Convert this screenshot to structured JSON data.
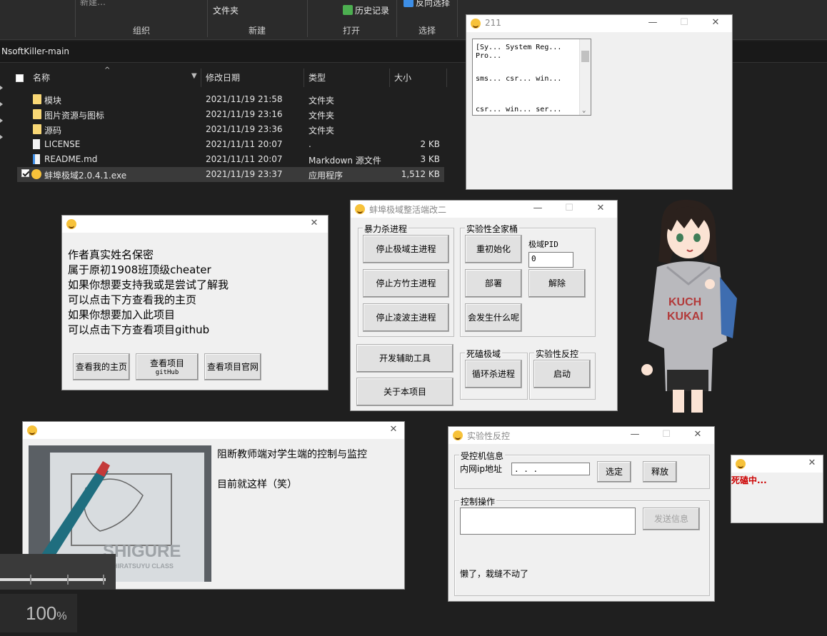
{
  "ribbon": {
    "top_text_1": "新建…",
    "folder_label": "文件夹",
    "history": "历史记录",
    "invert_select": "反向选择",
    "groups": [
      "组织",
      "新建",
      "打开",
      "选择"
    ]
  },
  "address": "NsoftKiller-main",
  "columns": {
    "name": "名称",
    "modified": "修改日期",
    "type": "类型",
    "size": "大小"
  },
  "files": [
    {
      "name": "模块",
      "modified": "2021/11/19 21:58",
      "type": "文件夹",
      "size": "",
      "icon": "folder-icon"
    },
    {
      "name": "图片资源与图标",
      "modified": "2021/11/19 23:16",
      "type": "文件夹",
      "size": "",
      "icon": "folder-icon"
    },
    {
      "name": "源码",
      "modified": "2021/11/19 23:36",
      "type": "文件夹",
      "size": "",
      "icon": "folder-icon"
    },
    {
      "name": "LICENSE",
      "modified": "2021/11/11 20:07",
      "type": ".",
      "size": "2 KB",
      "icon": "document-icon"
    },
    {
      "name": "README.md",
      "modified": "2021/11/11 20:07",
      "type": "Markdown 源文件",
      "size": "3 KB",
      "icon": "markdown-icon"
    },
    {
      "name": "蚌埠极域2.0.4.1.exe",
      "modified": "2021/11/19 23:37",
      "type": "应用程序",
      "size": "1,512 KB",
      "icon": "exe-icon",
      "selected": true
    }
  ],
  "win211": {
    "title": "211",
    "lines": [
      "[Sy... System Reg...",
      "Pro...",
      "sms... csr... win...",
      "csr... win... ser..."
    ]
  },
  "about": {
    "lines": [
      "作者真实姓名保密",
      "属于原初1908班顶级cheater",
      "如果你想要支持我或是尝试了解我",
      "可以点击下方查看我的主页",
      "如果你想要加入此项目",
      "可以点击下方查看项目github"
    ],
    "btn_home": "查看我的主页",
    "btn_project": "查看项目",
    "btn_project_sub": "gitHub",
    "btn_site": "查看项目官网"
  },
  "main": {
    "title": "蚌埠极域整活端改二",
    "group_kill": "暴力杀进程",
    "btn_kill_main": "停止极域主进程",
    "btn_kill_fangzhu": "停止方竹主进程",
    "btn_kill_lingbo": "停止凌波主进程",
    "group_exp": "实验性全家桶",
    "btn_reinit": "重初始化",
    "pid_label": "极域PID",
    "pid_value": "0",
    "btn_deploy": "部署",
    "btn_release": "解除",
    "btn_what": "会发生什么呢",
    "btn_devtools": "开发辅助工具",
    "btn_about": "关于本项目",
    "group_dead": "死磕极域",
    "btn_loop": "循环杀进程",
    "group_counter": "实验性反控",
    "btn_start": "启动"
  },
  "info": {
    "line1": "阻断教师端对学生端的控制与监控",
    "line2": "目前就这样（笑）",
    "photo_text": "SHIGURE",
    "photo_sub": "SHIRATSUYU CLASS"
  },
  "counter": {
    "title": "实验性反控",
    "group_info": "受控机信息",
    "ip_label": "内网ip地址",
    "ip_value": " .   .   . ",
    "btn_select": "选定",
    "btn_release": "释放",
    "group_ops": "控制操作",
    "btn_send": "发送信息",
    "status": "懒了，栽缝不动了"
  },
  "small": {
    "status": "死磕中..."
  },
  "zoom": {
    "value": "100",
    "unit": "%"
  },
  "colors": {
    "dark_bg": "#1f1f1f",
    "window_bg": "#f0f0f0",
    "alert_red": "#cc0000",
    "icon_yellow": "#f7c23a"
  }
}
